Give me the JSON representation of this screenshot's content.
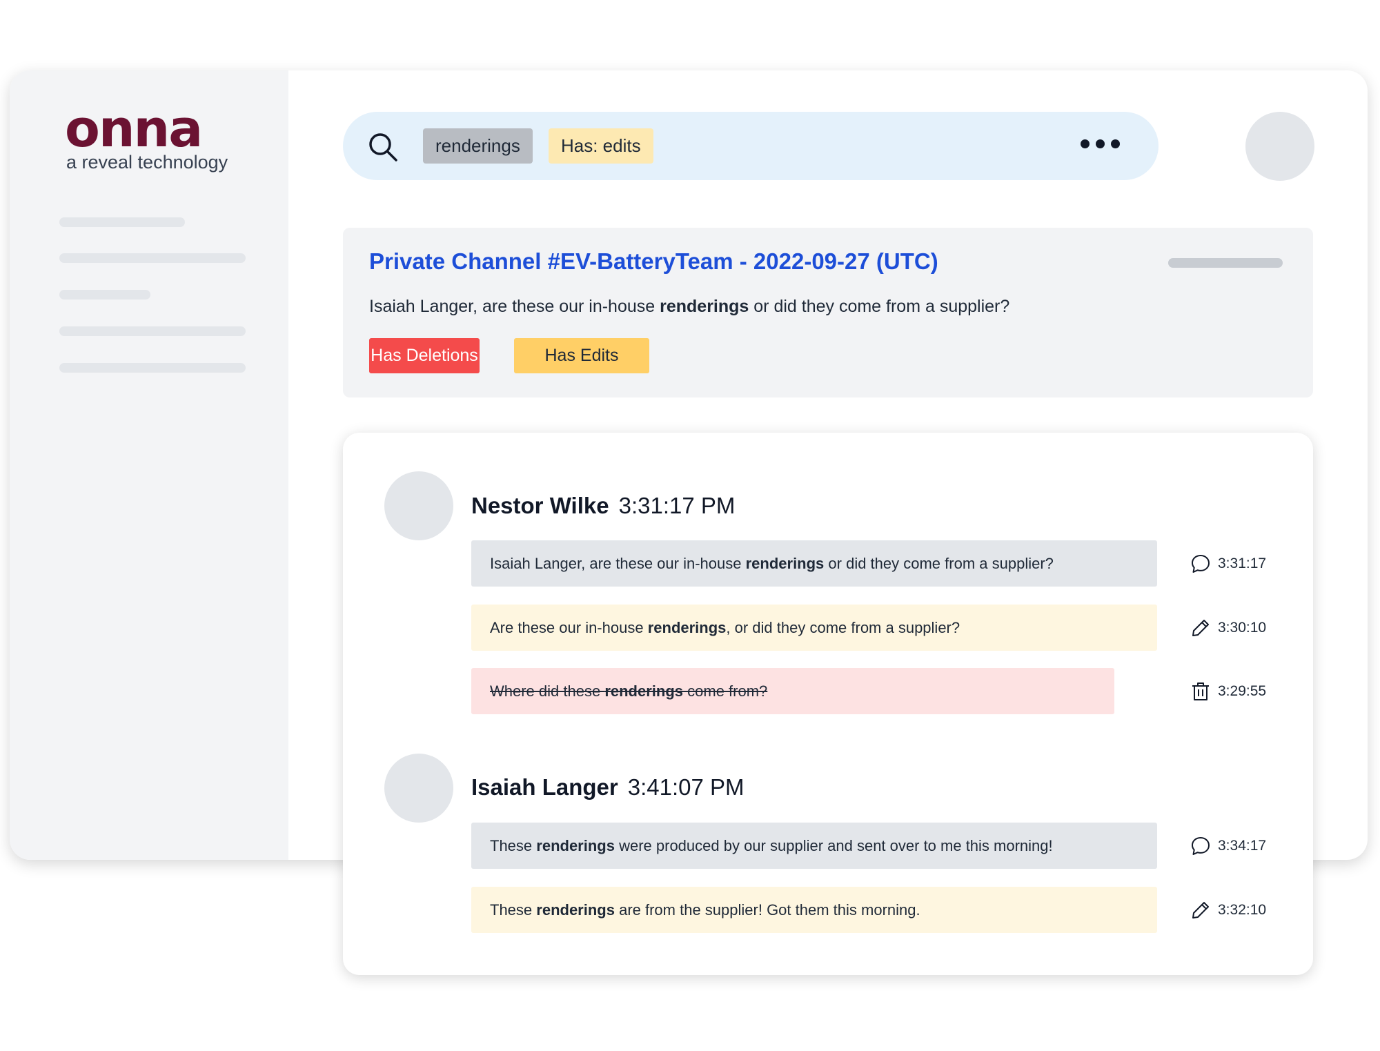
{
  "brand": {
    "logo": "onna",
    "tagline": "a reveal technology"
  },
  "search": {
    "chips": [
      "renderings",
      "Has: edits"
    ],
    "icon": "search-icon",
    "more_icon": "more-horizontal-icon"
  },
  "result_card": {
    "title": "Private Channel #EV-BatteryTeam - 2022-09-27 (UTC)",
    "snippet": {
      "before": "Isaiah Langer, are these our in-house ",
      "highlight": "renderings",
      "after": " or did they come from a supplier?"
    },
    "badges": [
      {
        "label": "Has Deletions",
        "color": "#f44b4b"
      },
      {
        "label": "Has Edits",
        "color": "#ffcf66"
      }
    ]
  },
  "thread": {
    "groups": [
      {
        "author": "Nestor Wilke",
        "time": "3:31:17 PM",
        "messages": [
          {
            "type": "message",
            "icon": "chat-bubble-icon",
            "before": "Isaiah Langer, are these our in-house ",
            "highlight": "renderings",
            "after": " or did they come from a supplier?",
            "time": "3:31:17"
          },
          {
            "type": "edit",
            "icon": "pencil-icon",
            "before": "Are these our in-house ",
            "highlight": "renderings",
            "after": ", or did they come from a supplier?",
            "time": "3:30:10"
          },
          {
            "type": "deletion",
            "icon": "trash-icon",
            "before": "Where did these ",
            "highlight": "renderings",
            "after": " come from?",
            "time": "3:29:55"
          }
        ]
      },
      {
        "author": "Isaiah Langer",
        "time": "3:41:07 PM",
        "messages": [
          {
            "type": "message",
            "icon": "chat-bubble-icon",
            "before": "These ",
            "highlight": "renderings",
            "after": " were produced by our supplier and sent over to me this morning!",
            "time": "3:34:17"
          },
          {
            "type": "edit",
            "icon": "pencil-icon",
            "before": "These ",
            "highlight": "renderings",
            "after": " are from the supplier! Got them this morning.",
            "time": "3:32:10"
          }
        ]
      }
    ]
  }
}
